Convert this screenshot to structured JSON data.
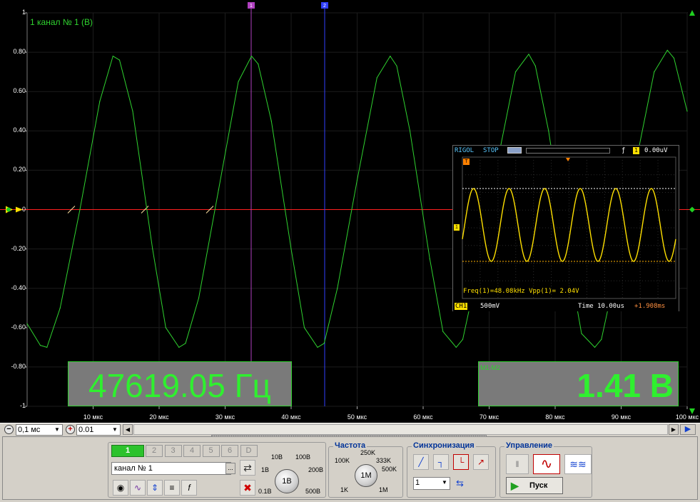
{
  "scope": {
    "channel_label": "1 канал № 1 (В)",
    "y_ticks": [
      "1",
      "0.80",
      "0.60",
      "0.40",
      "0.20",
      "0",
      "-0.20",
      "-0.40",
      "-0.60",
      "-0.80",
      "-1"
    ],
    "x_ticks": [
      "10 мкс",
      "20 мкс",
      "30 мкс",
      "40 мкс",
      "50 мкс",
      "60 мкс",
      "70 мкс",
      "80 мкс",
      "90 мкс",
      "100 мкс"
    ],
    "cursor_1_label": "1",
    "cursor_2_label": "2",
    "frequency_readout": "47619.05 Гц",
    "delta_caption": "M1-M2",
    "voltage_readout": "1.41 В",
    "trace_color": "#2fd22f",
    "zero_line_color": "#ff2020"
  },
  "chart_data": {
    "type": "line",
    "title": "",
    "xlabel": "",
    "ylabel": "",
    "xlim": [
      0,
      100
    ],
    "ylim": [
      -1,
      1
    ],
    "x_unit": "мкс",
    "grid": true,
    "series": [
      {
        "x": [
          0,
          2,
          3,
          5,
          8,
          11,
          13,
          14,
          16,
          19,
          21,
          23,
          24,
          26,
          29,
          32,
          34,
          35,
          37,
          40,
          42,
          44,
          45,
          47,
          50,
          53,
          55,
          56,
          58,
          61,
          63,
          65,
          66,
          68,
          71,
          74,
          76,
          77,
          79,
          82,
          84,
          86,
          87,
          89,
          92,
          95,
          97,
          98,
          100
        ],
        "y": [
          -0.58,
          -0.69,
          -0.7,
          -0.5,
          0.0,
          0.55,
          0.78,
          0.76,
          0.5,
          -0.2,
          -0.6,
          -0.7,
          -0.68,
          -0.45,
          0.1,
          0.65,
          0.78,
          0.74,
          0.45,
          -0.2,
          -0.6,
          -0.7,
          -0.68,
          -0.4,
          0.15,
          0.67,
          0.78,
          0.73,
          0.4,
          -0.25,
          -0.62,
          -0.7,
          -0.66,
          -0.35,
          0.2,
          0.7,
          0.79,
          0.73,
          0.4,
          -0.25,
          -0.63,
          -0.7,
          -0.66,
          -0.35,
          0.2,
          0.7,
          0.81,
          0.77,
          0.5
        ]
      }
    ]
  },
  "rigol": {
    "brand": "RIGOL",
    "status": "STOP",
    "trigger_level": "0.00uV",
    "trigger_channel": "1",
    "trig_marker": "T",
    "channel_marker": "1",
    "measure_text": "Freq(1)=48.08kHz  Vpp(1)= 2.04V",
    "ch_label": "CH1",
    "volts_div": "500mV",
    "time_div": "Time 10.00us",
    "time_offset": "+1.908ms"
  },
  "toolbar": {
    "timebase": "0,1 мс",
    "amplitude": "0.01"
  },
  "panel": {
    "channels": [
      "1",
      "2",
      "3",
      "4",
      "5",
      "6",
      "D"
    ],
    "channel_name": "канал № 1",
    "channel_more": "...",
    "volt_knob_labels": [
      "10В",
      "100В",
      "1В",
      "200В",
      "0.1В",
      "500В"
    ],
    "volt_knob_value": "1В",
    "freq_title": "Частота",
    "freq_knob_labels": [
      "250K",
      "100K",
      "333K",
      "500K",
      "1K",
      "1M"
    ],
    "freq_knob_value": "1M",
    "sync_title": "Синхронизация",
    "sync_channel": "1",
    "control_title": "Управление",
    "start_label": "Пуск"
  }
}
